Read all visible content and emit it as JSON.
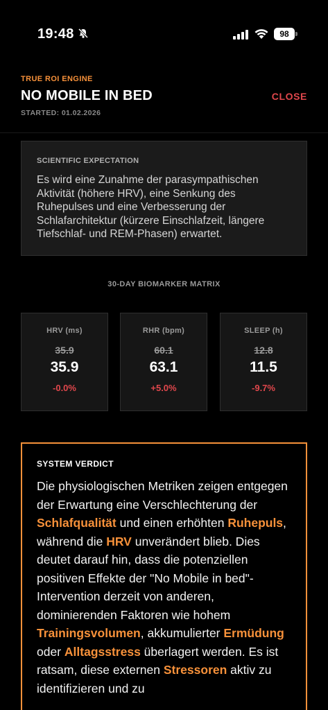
{
  "status_bar": {
    "time": "19:48",
    "battery": "98"
  },
  "header": {
    "eyebrow": "TRUE ROI ENGINE",
    "title": "NO MOBILE IN BED",
    "started": "STARTED: 01.02.2026",
    "close_label": "CLOSE"
  },
  "expectation": {
    "label": "SCIENTIFIC EXPECTATION",
    "text": "Es wird eine Zunahme der parasympathischen Aktivität (höhere HRV), eine Senkung des Ruhepulses und eine Verbesserung der Schlafarchitektur (kürzere Einschlafzeit, längere Tiefschlaf- und REM-Phasen) erwartet."
  },
  "matrix": {
    "title": "30-DAY BIOMARKER MATRIX",
    "cards": [
      {
        "label": "HRV (ms)",
        "old": "35.9",
        "value": "35.9",
        "delta": "-0.0%",
        "delta_color": "#e0474c"
      },
      {
        "label": "RHR (bpm)",
        "old": "60.1",
        "value": "63.1",
        "delta": "+5.0%",
        "delta_color": "#e0474c"
      },
      {
        "label": "SLEEP (h)",
        "old": "12.8",
        "value": "11.5",
        "delta": "-9.7%",
        "delta_color": "#e0474c"
      }
    ]
  },
  "verdict": {
    "label": "SYSTEM VERDICT",
    "segments": [
      {
        "t": "Die physiologischen Metriken zeigen entgegen der Erwartung eine Verschlechterung der ",
        "h": false
      },
      {
        "t": "Schlafqualität",
        "h": true
      },
      {
        "t": " und einen erhöhten ",
        "h": false
      },
      {
        "t": "Ruhepuls",
        "h": true
      },
      {
        "t": ", während die ",
        "h": false
      },
      {
        "t": "HRV",
        "h": true
      },
      {
        "t": " unverändert blieb. Dies deutet darauf hin, dass die potenziellen positiven Effekte der \"No Mobile in bed\"-Intervention derzeit von anderen, dominierenden Faktoren wie hohem ",
        "h": false
      },
      {
        "t": "Trainingsvolumen",
        "h": true
      },
      {
        "t": ", akkumulierter ",
        "h": false
      },
      {
        "t": "Ermüdung",
        "h": true
      },
      {
        "t": " oder ",
        "h": false
      },
      {
        "t": "Alltagsstress",
        "h": true
      },
      {
        "t": " überlagert werden. Es ist ratsam, diese externen ",
        "h": false
      },
      {
        "t": "Stressoren",
        "h": true
      },
      {
        "t": " aktiv zu identifizieren und zu",
        "h": false
      }
    ]
  },
  "colors": {
    "accent": "#f7913a",
    "negative": "#e0474c",
    "background": "#000000"
  }
}
